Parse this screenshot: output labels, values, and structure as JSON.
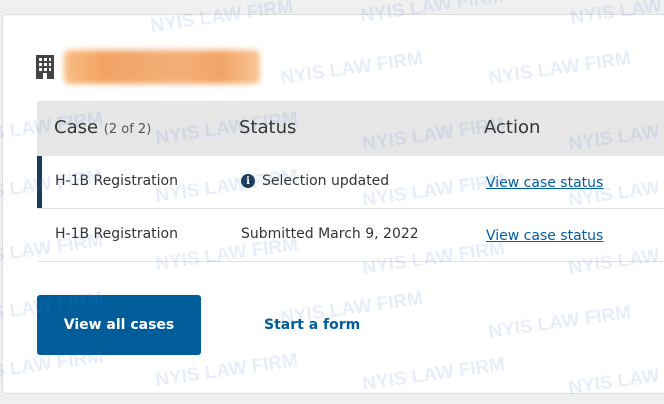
{
  "table": {
    "headers": {
      "case": "Case",
      "case_count": "(2 of 2)",
      "status": "Status",
      "action": "Action"
    },
    "rows": [
      {
        "case": "H-1B Registration",
        "status": "Selection updated",
        "status_icon": "info-icon",
        "action": "View case status"
      },
      {
        "case": "H-1B Registration",
        "status": "Submitted March 9, 2022",
        "action": "View case status"
      }
    ]
  },
  "actions": {
    "view_all": "View all cases",
    "start_form": "Start a form"
  },
  "watermark": "NYIS LAW FIRM",
  "colors": {
    "primary": "#005d99",
    "link": "#005ea2",
    "accent_bar": "#1b3a5c",
    "header_bg": "#e6e6e6"
  }
}
